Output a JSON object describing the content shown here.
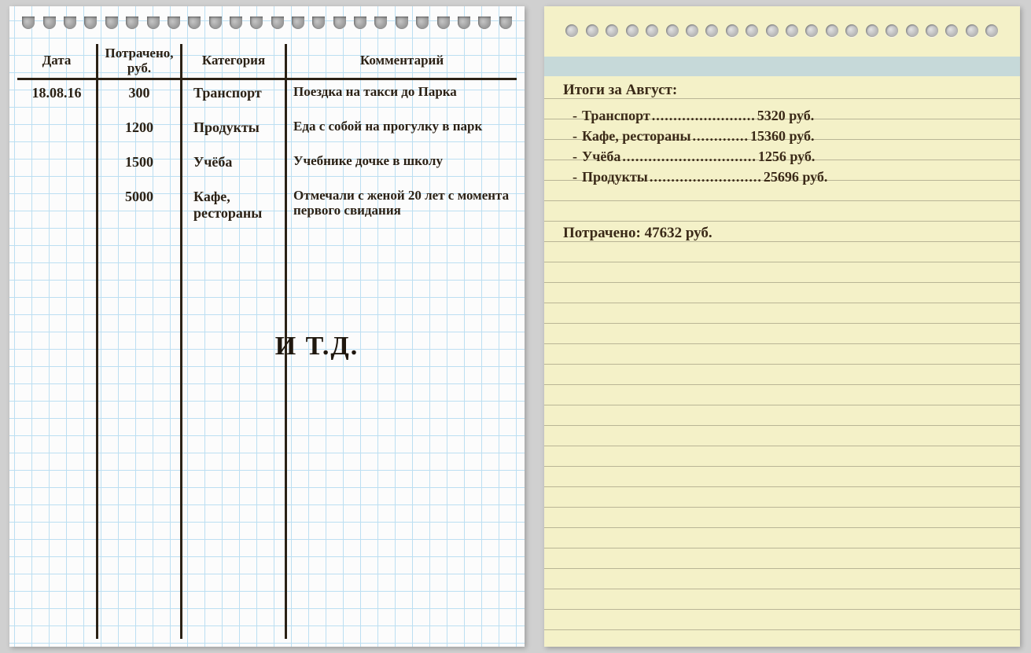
{
  "ledger": {
    "headers": {
      "date": "Дата",
      "spent": "Потрачено, руб.",
      "category": "Категория",
      "comment": "Комментарий"
    },
    "rows": [
      {
        "date": "18.08.16",
        "spent": "300",
        "category": "Транспорт",
        "comment": "Поездка на такси до Парка"
      },
      {
        "date": "",
        "spent": "1200",
        "category": "Продукты",
        "comment": "Еда с собой на прогулку в парк"
      },
      {
        "date": "",
        "spent": "1500",
        "category": "Учёба",
        "comment": "Учебнике дочке в школу"
      },
      {
        "date": "",
        "spent": "5000",
        "category": "Кафе, рестораны",
        "comment": "Отмечали с женой 20 лет с момента первого свидания"
      }
    ],
    "etc": "И Т.Д."
  },
  "summary": {
    "title": "Итоги за Август:",
    "items": [
      {
        "label": "Транспорт",
        "value": "5320 руб."
      },
      {
        "label": "Кафе, рестораны",
        "value": "15360 руб."
      },
      {
        "label": "Учёба",
        "value": "1256 руб."
      },
      {
        "label": "Продукты",
        "value": "25696 руб."
      }
    ],
    "total": "Потрачено: 47632 руб."
  }
}
